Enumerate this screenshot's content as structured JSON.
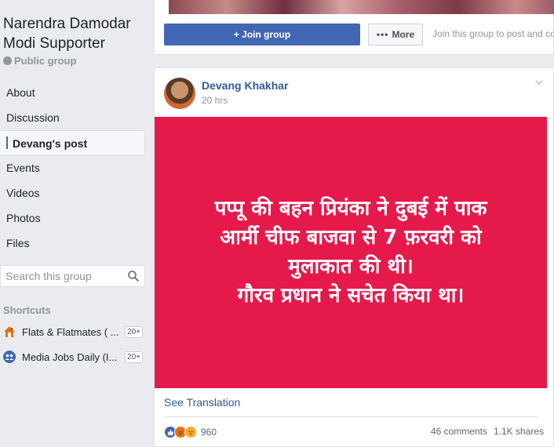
{
  "group": {
    "name": "Narendra Damodar Modi Supporter",
    "privacy": "Public group"
  },
  "nav": {
    "items": [
      {
        "label": "About"
      },
      {
        "label": "Discussion"
      },
      {
        "label": "Devang's post"
      },
      {
        "label": "Events"
      },
      {
        "label": "Videos"
      },
      {
        "label": "Photos"
      },
      {
        "label": "Files"
      }
    ],
    "active_index": 2
  },
  "search": {
    "placeholder": "Search this group"
  },
  "shortcuts": {
    "title": "Shortcuts",
    "items": [
      {
        "label": "Flats & Flatmates ( ...",
        "badge": "20+",
        "icon": "house-icon"
      },
      {
        "label": "Media Jobs Daily (I...",
        "badge": "20+",
        "icon": "group-icon"
      }
    ]
  },
  "header_actions": {
    "join_label": "+ Join group",
    "more_label": "More",
    "hint": "Join this group to post and co"
  },
  "post": {
    "author": "Devang Khakhar",
    "time": "20 hrs",
    "image_text_lines": [
      "पप्पू की बहन प्रियंका ने दुबई में पाक",
      "आर्मी चीफ बाजवा से 7 फ़रवरी को",
      "मुलाकात की थी।",
      "गौरव प्रधान ने सचेत किया था।"
    ],
    "see_translation": "See Translation",
    "reaction_count": "960",
    "comments": "46 comments",
    "shares": "1.1K shares"
  },
  "colors": {
    "brand": "#4267b2",
    "post_image_bg": "#e6194b",
    "link": "#365899"
  }
}
